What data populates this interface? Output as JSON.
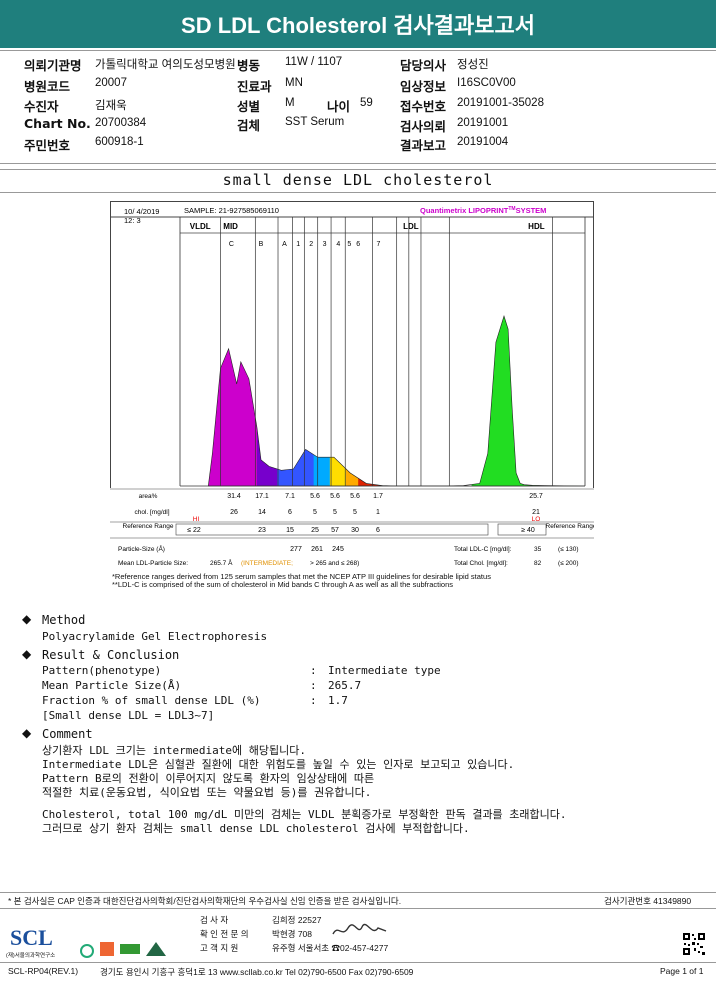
{
  "report_title": "SD LDL Cholesterol 검사결과보고서",
  "patient": {
    "institution_label": "의뢰기관명",
    "institution": "가톨릭대학교 여의도성모병원",
    "ward_label": "병동",
    "ward": "11W / 1107",
    "doctor_label": "담당의사",
    "doctor": "정성진",
    "hospital_code_label": "병원코드",
    "hospital_code": "20007",
    "dept_label": "진료과",
    "dept": "MN",
    "clinical_label": "임상정보",
    "clinical": "I16SC0V00",
    "examinee_label": "수진자",
    "examinee": "김재욱",
    "sex_label": "성별",
    "sex": "M",
    "age_label": "나이",
    "age": "59",
    "receipt_label": "접수번호",
    "receipt": "20191001-35028",
    "chart_label": "Chart No.",
    "chart": "20700384",
    "specimen_label": "검체",
    "specimen": "SST Serum",
    "request_label": "검사의뢰",
    "request": "20191001",
    "id_label": "주민번호",
    "id": "600918-1",
    "report_label": "결과보고",
    "report": "20191004"
  },
  "section_title": "small dense LDL cholesterol",
  "chart_data": {
    "type": "area",
    "header": {
      "datetime_line1": "10/ 4/2019",
      "datetime_line2": "12: 3",
      "sample": "SAMPLE:  21-927585069110",
      "brand": "Quantimetrix LIPOPRINT",
      "brand_tm": "TM",
      "brand_suffix": "SYSTEM"
    },
    "bands": [
      {
        "label": "VLDL"
      },
      {
        "label": "MID"
      },
      {
        "label": "LDL"
      },
      {
        "label": "HDL"
      }
    ],
    "subbands": [
      "C",
      "B",
      "A",
      "1",
      "2",
      "3",
      "4",
      "5",
      "6",
      "7"
    ],
    "x": [
      0.07,
      0.08,
      0.1,
      0.12,
      0.14,
      0.15,
      0.17,
      0.19,
      0.2,
      0.22,
      0.25,
      0.28,
      0.31,
      0.34,
      0.38,
      0.42,
      0.46,
      0.5,
      0.53,
      0.55,
      0.58,
      0.62,
      0.66,
      0.7,
      0.74,
      0.76,
      0.78,
      0.8,
      0.81,
      0.82,
      0.83,
      0.84,
      0.85,
      0.87,
      0.9,
      1.0
    ],
    "y": [
      0,
      25,
      90,
      105,
      78,
      95,
      82,
      45,
      20,
      15,
      12,
      13,
      28,
      22,
      22,
      10,
      2,
      0.3,
      0.1,
      0.1,
      0.1,
      0.1,
      0.1,
      0.3,
      2,
      25,
      110,
      130,
      120,
      60,
      10,
      2,
      1,
      0.5,
      0.3,
      0
    ],
    "table": {
      "area_label": "area%",
      "area": [
        "31.4",
        "17.1",
        "7.1",
        "5.6",
        "5.6",
        "5.6",
        "1.7",
        "25.7"
      ],
      "chol_label": "chol. [mg/dl]",
      "chol": [
        "26",
        "14",
        "6",
        "5",
        "5",
        "5",
        "1",
        "21"
      ],
      "hi": "HI",
      "lo": "LO",
      "ref_label": "Reference Range",
      "ref": [
        "≤ 22",
        "23",
        "15",
        "25",
        "57",
        "30",
        "6"
      ],
      "ref_hdl": "≥ 40",
      "ref_right_label": "Reference Range",
      "particle_size_label": "Particle-Size (Å)",
      "particle_sizes": [
        "277",
        "261",
        "245"
      ],
      "mean_label": "Mean LDL-Particle Size:",
      "mean_value": "265.7 Å",
      "mean_class": "(INTERMEDIATE;",
      "mean_range": "> 265 and ≤ 268)",
      "total_ldl_label": "Total LDL-C [mg/dl]:",
      "total_ldl": "35",
      "total_ldl_ref": "(≤ 130)",
      "total_chol_label": "Total Chol. [mg/dl]:",
      "total_chol": "82",
      "total_chol_ref": "(≤ 200)"
    },
    "colors": {
      "vldl": "#cc00cc",
      "c": "#7700cc",
      "b": "#3355ff",
      "a": "#00aaff",
      "ldl1": "#ffdd00",
      "ldl2": "#ffaa00",
      "ldl3": "#dd2200",
      "hdl": "#22dd22"
    }
  },
  "notes": [
    "*Reference ranges derived from 125 serum samples that met the NCEP ATP III guidelines for desirable lipid status",
    "**LDL-C is comprised of the sum of cholesterol in Mid bands C through A as well as all the subfractions"
  ],
  "method": {
    "heading": "Method",
    "text": "Polyacrylamide Gel Electrophoresis"
  },
  "result": {
    "heading": "Result & Conclusion",
    "rows": [
      {
        "label": "Pattern(phenotype)",
        "value": "Intermediate type"
      },
      {
        "label": "Mean Particle Size(Å)",
        "value": "265.7"
      },
      {
        "label": "Fraction % of small dense LDL (%)",
        "value": "1.7"
      }
    ],
    "colon": ":",
    "note": "[Small dense LDL = LDL3~7]"
  },
  "comment": {
    "heading": "Comment",
    "lines": [
      "상기환자 LDL 크기는 intermediate에 해당됩니다.",
      "Intermediate LDL은 심혈관 질환에 대한 위험도를 높일 수 있는 인자로 보고되고 있습니다.",
      "Pattern B로의 전환이 이루어지지 않도록 환자의 임상상태에 따른",
      "적절한 치료(운동요법, 식이요법 또는 약물요법 등)를 권유합니다.",
      "Cholesterol, total 100 mg/dL 미만의 검체는 VLDL 분획증가로 부정확한 판독 결과를 초래합니다.",
      "그러므로 상기 환자 검체는 small dense LDL cholesterol 검사에 부적합합니다."
    ]
  },
  "footer": {
    "disclaimer": "* 본 검사실은 CAP 인증과 대한진단검사의학회/진단검사의학재단의 우수검사실 신임 인증을 받은 검사실입니다.",
    "cert_no": "검사기관번호 41349890",
    "logo": "SCL",
    "logo_sub": "(재)서울의과학연구소",
    "staff": [
      {
        "role": "검 사 자",
        "name": "김희정 22527"
      },
      {
        "role": "확 인 전 문 의",
        "name": "박현경 708"
      },
      {
        "role": "고 객 지 원",
        "name": "유주형 서울서초 ☎02-457-4277"
      }
    ],
    "form_no": "SCL-RP04(REV.1)",
    "address": "경기도 용인시 기흥구 흥덕1로 13    www.scllab.co.kr  Tel 02)790-6500  Fax 02)790-6509",
    "page": "Page 1 of 1"
  }
}
